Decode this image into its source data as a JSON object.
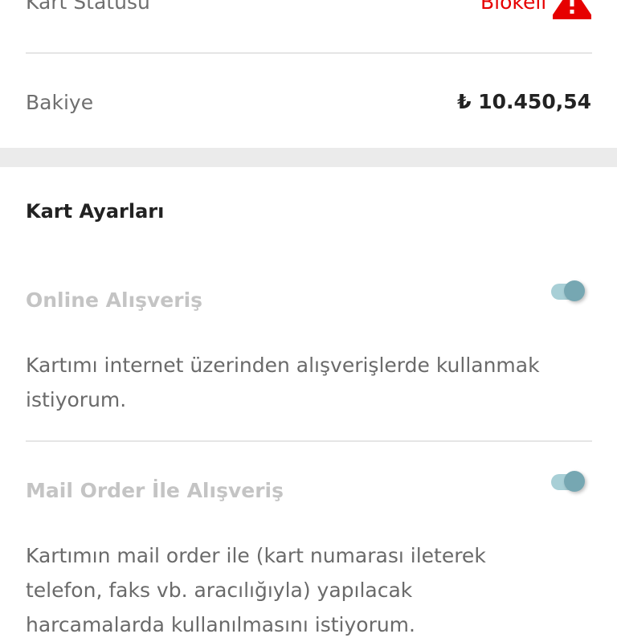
{
  "card_info": {
    "status_label": "Kart Statüsü",
    "status_value": "Blokeli",
    "status_icon": "warning-triangle-icon",
    "balance_label": "Bakiye",
    "balance_value": "₺ 10.450,54"
  },
  "settings": {
    "title": "Kart Ayarları",
    "items": [
      {
        "title": "Online Alışveriş",
        "description": "Kartımı internet üzerinden alışverişlerde kullanmak istiyorum.",
        "enabled": true
      },
      {
        "title": "Mail Order İle Alışveriş",
        "description": "Kartımın mail order ile (kart numarası ileterek telefon, faks vb. aracılığıyla) yapılacak harcamalarda kullanılmasını istiyorum.",
        "enabled": true
      }
    ]
  },
  "colors": {
    "accent_red": "#e60000",
    "toggle_track": "#a8cfd6",
    "toggle_knob": "#76a7b2"
  }
}
